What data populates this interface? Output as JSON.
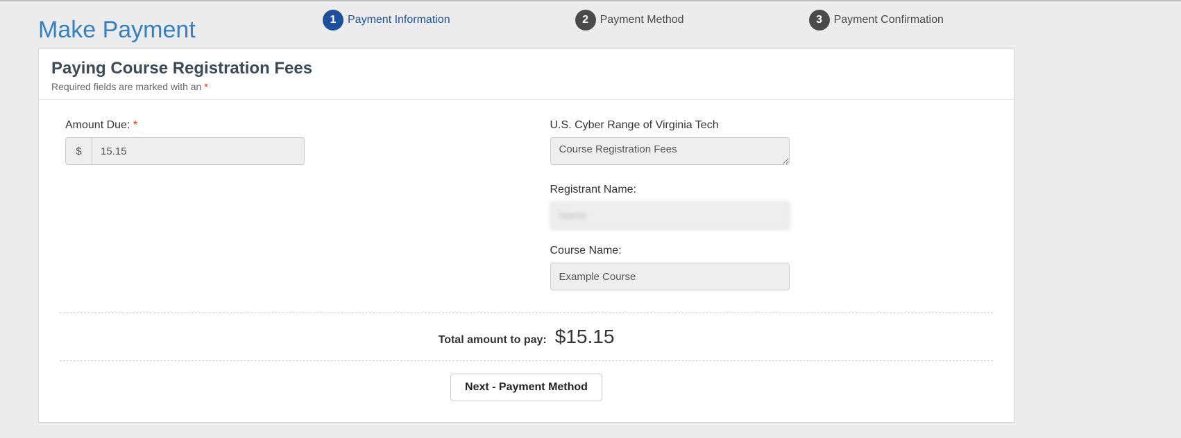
{
  "header": {
    "title": "Make Payment"
  },
  "steps": [
    {
      "num": "1",
      "label": "Payment Information",
      "active": true
    },
    {
      "num": "2",
      "label": "Payment Method",
      "active": false
    },
    {
      "num": "3",
      "label": "Payment Confirmation",
      "active": false
    }
  ],
  "panel": {
    "title": "Paying Course Registration Fees",
    "required_note_prefix": "Required fields are marked with an ",
    "required_star": "*"
  },
  "form": {
    "amount_due": {
      "label": "Amount Due: ",
      "star": "*",
      "currency": "$",
      "value": "15.15"
    },
    "org": {
      "label": "U.S. Cyber Range of Virginia Tech",
      "value": "Course Registration Fees"
    },
    "registrant": {
      "label": "Registrant Name:",
      "value": "Name"
    },
    "course": {
      "label": "Course Name:",
      "value": "Example Course"
    }
  },
  "total": {
    "label": "Total amount to pay:",
    "value": "$15.15"
  },
  "buttons": {
    "next": "Next - Payment Method"
  }
}
